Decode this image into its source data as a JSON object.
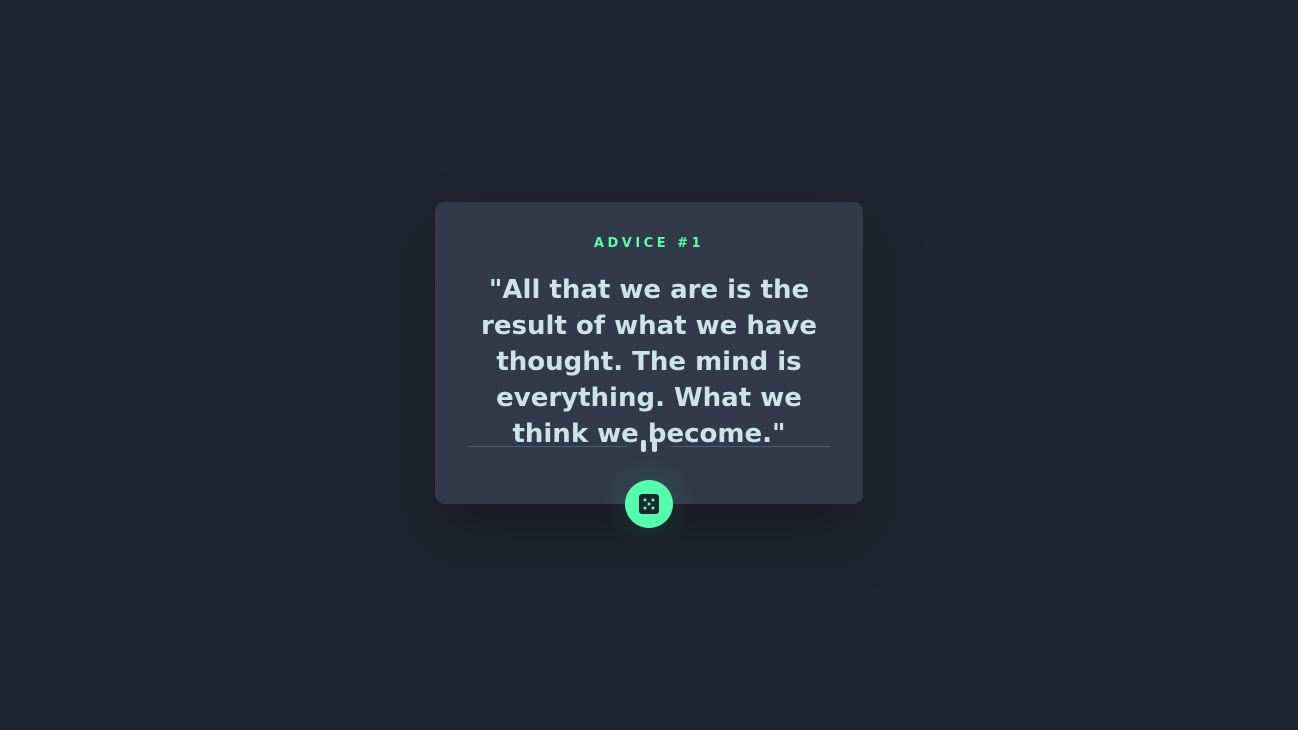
{
  "advice": {
    "label": "ADVICE #1",
    "text": "\"All that we are is the result of what we have thought. The mind is everything. What we think we become.\""
  },
  "icons": {
    "divider": "pause-icon",
    "button": "dice-icon"
  },
  "colors": {
    "background": "#1f2430",
    "card": "#323a49",
    "accent": "#53ffaa",
    "text": "#cee3e9",
    "divider": "#4f5d74"
  }
}
